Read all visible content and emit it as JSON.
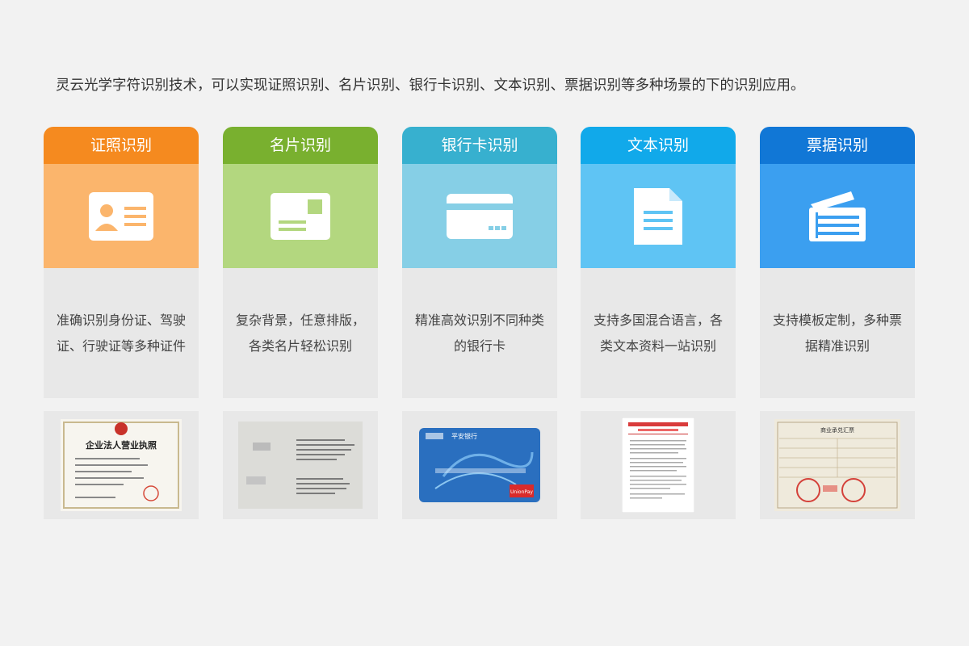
{
  "intro_text": "灵云光学字符识别技术，可以实现证照识别、名片识别、银行卡识别、文本识别、票据识别等多种场景的下的识别应用。",
  "cards": [
    {
      "title": "证照识别",
      "description": "准确识别身份证、驾驶证、行驶证等多种证件",
      "icon": "id-card-icon",
      "sample_image": "business-license-sample",
      "sample_text": {
        "title": "企业法人营业执照"
      }
    },
    {
      "title": "名片识别",
      "description": "复杂背景，任意排版，各类名片轻松识别",
      "icon": "business-card-icon",
      "sample_image": "business-card-sample"
    },
    {
      "title": "银行卡识别",
      "description": "精准高效识别不同种类的银行卡",
      "icon": "bank-card-icon",
      "sample_image": "bank-card-sample",
      "sample_text": {
        "bank": "平安银行",
        "brand": "UnionPay"
      }
    },
    {
      "title": "文本识别",
      "description": "支持多国混合语言，各类文本资料一站识别",
      "icon": "document-icon",
      "sample_image": "text-document-sample"
    },
    {
      "title": "票据识别",
      "description": "支持模板定制，多种票据精准识别",
      "icon": "receipt-icon",
      "sample_image": "bill-sample",
      "sample_text": {
        "title": "商业承兑汇票"
      }
    }
  ],
  "colors": {
    "background": "#f2f2f2",
    "card_1": "#f58a1f",
    "card_2": "#79b02f",
    "card_3": "#37b0cf",
    "card_4": "#11a9ea",
    "card_5": "#1177d6",
    "description_bg": "#e8e8e8"
  }
}
